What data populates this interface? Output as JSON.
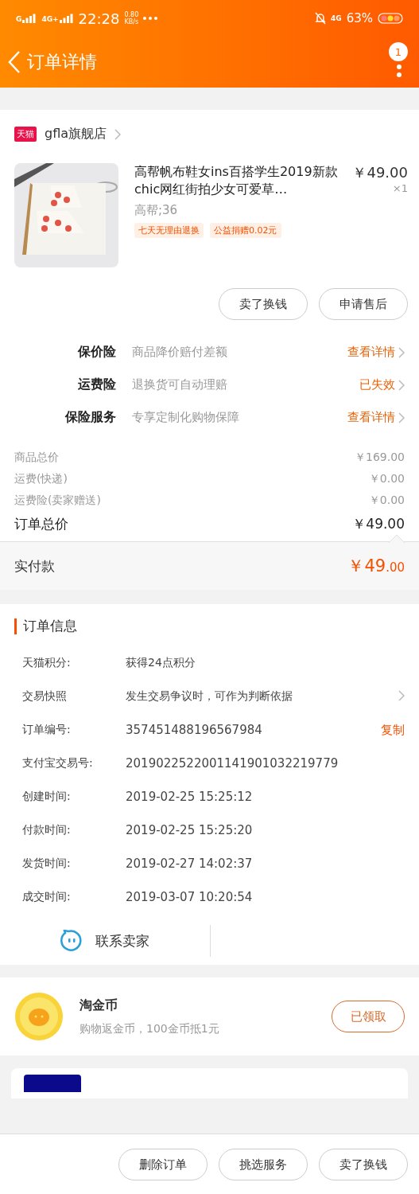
{
  "status_bar": {
    "signals": [
      "G",
      "4G+"
    ],
    "time": "22:28",
    "speed_value": "0.80",
    "speed_unit": "KB/s",
    "right_network": "4G",
    "battery": "63%"
  },
  "header": {
    "title": "订单详情",
    "badge": "1"
  },
  "store": {
    "tag": "天猫",
    "name": "gfla旗舰店"
  },
  "product": {
    "title": "高帮帆布鞋女ins百搭学生2019新款chic网红街拍少女可爱草…",
    "price": "￥49.00",
    "quantity": "×1",
    "sku": "高帮;36",
    "tags": [
      "七天无理由退换",
      "公益捐赠0.02元"
    ],
    "image": {
      "kind": "picture"
    }
  },
  "item_buttons": [
    "卖了换钱",
    "申请售后"
  ],
  "insurance": [
    {
      "name": "保价险",
      "desc": "商品降价赔付差额",
      "action": "查看详情"
    },
    {
      "name": "运费险",
      "desc": "退换货可自动理赔",
      "action": "已失效"
    },
    {
      "name": "保险服务",
      "desc": "专享定制化购物保障",
      "action": "查看详情"
    }
  ],
  "price_lines": [
    {
      "label": "商品总价",
      "value": "￥169.00",
      "kind": "minor"
    },
    {
      "label": "运费(快递)",
      "value": "￥0.00",
      "kind": "minor"
    },
    {
      "label": "运费险(卖家赠送)",
      "value": "￥0.00",
      "kind": "minor"
    },
    {
      "label": "订单总价",
      "value": "￥49.00",
      "kind": "total"
    }
  ],
  "paid": {
    "label": "实付款",
    "value_main": "￥49",
    "value_cents": ".00"
  },
  "order_info": {
    "title": "订单信息",
    "rows": [
      {
        "label": "天猫积分:",
        "value": "获得24点积分",
        "kind": "text"
      },
      {
        "label": "交易快照",
        "value": "发生交易争议时，可作为判断依据",
        "kind": "chevron"
      },
      {
        "label": "订单编号:",
        "value": "357451488196567984",
        "kind": "action",
        "action": "复制"
      },
      {
        "label": "支付宝交易号:",
        "value": "2019022522001141901032219779",
        "kind": "text"
      },
      {
        "label": "创建时间:",
        "value": "2019-02-25 15:25:12",
        "kind": "text"
      },
      {
        "label": "付款时间:",
        "value": "2019-02-25 15:25:20",
        "kind": "text"
      },
      {
        "label": "发货时间:",
        "value": "2019-02-27 14:02:37",
        "kind": "text"
      },
      {
        "label": "成交时间:",
        "value": "2019-03-07 10:20:54",
        "kind": "text"
      }
    ],
    "contact": "联系卖家"
  },
  "coin": {
    "title": "淘金币",
    "desc": "购物返金币，100金币抵1元",
    "button": "已领取"
  },
  "bottom_buttons": [
    "删除订单",
    "挑选服务",
    "卖了换钱"
  ]
}
